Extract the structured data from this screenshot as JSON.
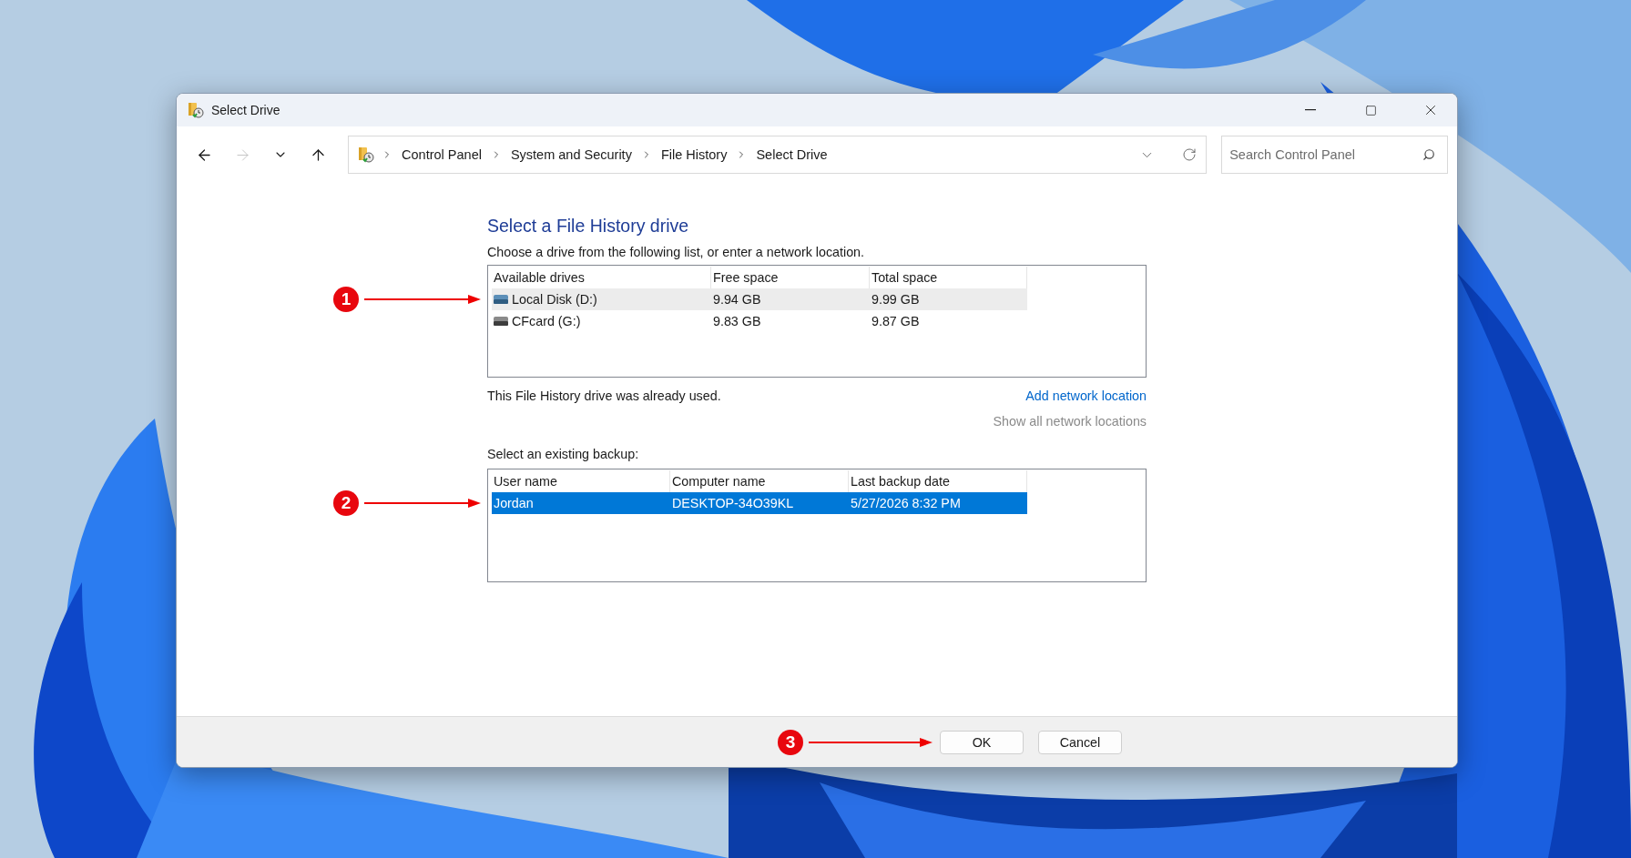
{
  "window": {
    "title": "Select Drive"
  },
  "nav_buttons": [
    {
      "kind": "back",
      "disabled": false
    },
    {
      "kind": "forward",
      "disabled": true
    },
    {
      "kind": "recent",
      "disabled": false
    },
    {
      "kind": "up",
      "disabled": false
    }
  ],
  "breadcrumb": [
    "Control Panel",
    "System and Security",
    "File History",
    "Select Drive"
  ],
  "search": {
    "placeholder": "Search Control Panel"
  },
  "heading": "Select a File History drive",
  "instruction": "Choose a drive from the following list, or enter a network location.",
  "drives": {
    "marker": "1",
    "columns": [
      "Available drives",
      "Free space",
      "Total space"
    ],
    "rows": [
      {
        "kind": "disk",
        "name": "Local Disk (D:)",
        "free": "9.94 GB",
        "total": "9.99 GB",
        "selected": true
      },
      {
        "kind": "card",
        "name": "CFcard (G:)",
        "free": "9.83 GB",
        "total": "9.87 GB",
        "selected": false
      }
    ]
  },
  "drive_note": "This File History drive was already used.",
  "links": [
    {
      "label": "Add network location",
      "disabled": false
    },
    {
      "label": "Show all network locations",
      "disabled": true
    }
  ],
  "backup_label": "Select an existing backup:",
  "backups": {
    "marker": "2",
    "columns": [
      "User name",
      "Computer name",
      "Last backup date"
    ],
    "rows": [
      {
        "user": "Jordan",
        "computer": "DESKTOP-34O39KL",
        "date": "5/27/2026 8:32 PM",
        "selected": true
      }
    ]
  },
  "buttons": [
    {
      "label": "OK",
      "marker": "3"
    },
    {
      "label": "Cancel"
    }
  ]
}
